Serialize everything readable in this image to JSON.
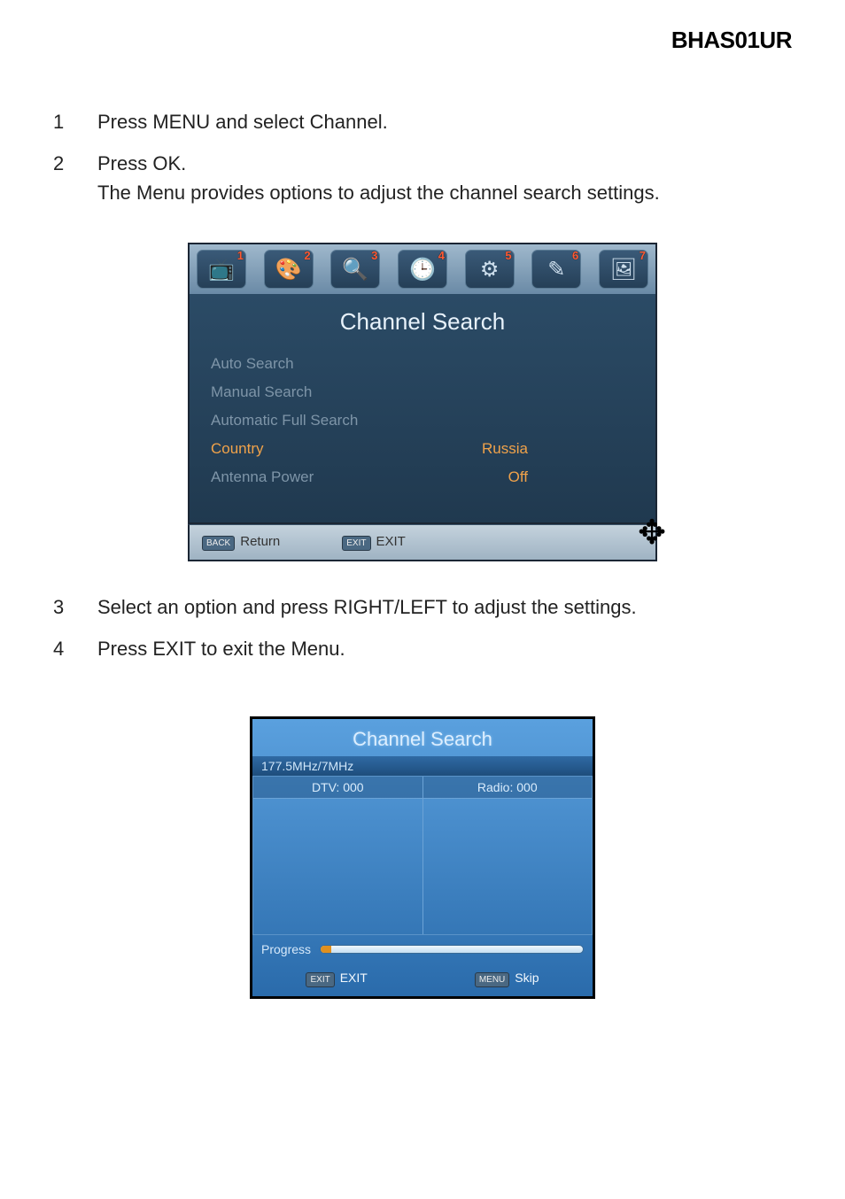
{
  "header": {
    "model": "BHAS01UR"
  },
  "steps": [
    {
      "num": "1",
      "text": "Press MENU and select Channel."
    },
    {
      "num": "2",
      "text": "Press OK.",
      "text2": "The Menu provides options to adjust the channel search settings."
    },
    {
      "num": "3",
      "text": "Select an option and press RIGHT/LEFT to adjust the settings."
    },
    {
      "num": "4",
      "text": "Press EXIT to exit the Menu."
    }
  ],
  "shot1": {
    "tabs": [
      {
        "num": "1",
        "icon": "📺"
      },
      {
        "num": "2",
        "icon": "🎨"
      },
      {
        "num": "3",
        "icon": "🔍"
      },
      {
        "num": "4",
        "icon": "🕒"
      },
      {
        "num": "5",
        "icon": "⚙"
      },
      {
        "num": "6",
        "icon": "✎"
      },
      {
        "num": "7",
        "icon": "🖼"
      }
    ],
    "title": "Channel Search",
    "rows": {
      "auto_search": "Auto Search",
      "manual_search": "Manual Search",
      "automatic_full_search": "Automatic Full Search",
      "country_label": "Country",
      "country_value": "Russia",
      "antenna_label": "Antenna Power",
      "antenna_value": "Off"
    },
    "footer": {
      "return_badge": "BACK",
      "return_label": "Return",
      "exit_badge": "EXIT",
      "exit_label": "EXIT"
    }
  },
  "shot2": {
    "title": "Channel Search",
    "frequency": "177.5MHz/7MHz",
    "col1": "DTV: 000",
    "col2": "Radio: 000",
    "progress_label": "Progress",
    "footer": {
      "exit_badge": "EXIT",
      "exit_label": "EXIT",
      "skip_badge": "MENU",
      "skip_label": "Skip"
    }
  }
}
